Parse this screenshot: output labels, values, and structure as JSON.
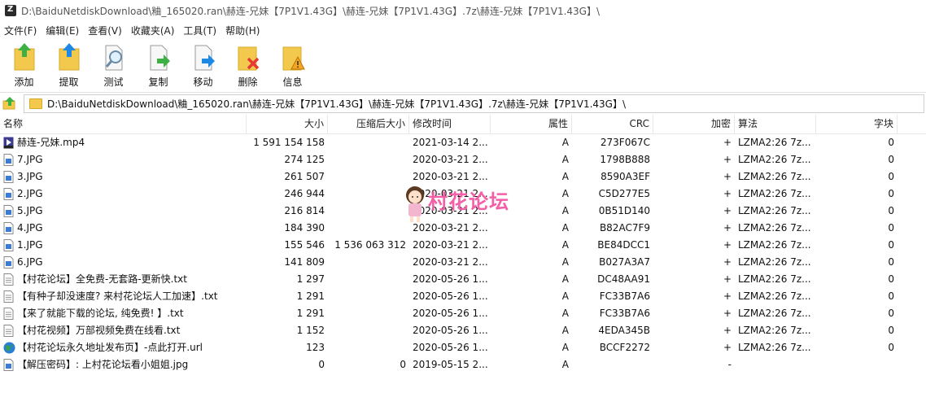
{
  "window": {
    "title": "D:\\BaiduNetdiskDownload\\粬_165020.ran\\赫连-兄妹【7P1V1.43G】\\赫连-兄妹【7P1V1.43G】.7z\\赫连-兄妹【7P1V1.43G】\\"
  },
  "menu": [
    {
      "label": "文件(F)"
    },
    {
      "label": "编辑(E)"
    },
    {
      "label": "查看(V)"
    },
    {
      "label": "收藏夹(A)"
    },
    {
      "label": "工具(T)"
    },
    {
      "label": "帮助(H)"
    }
  ],
  "toolbar": [
    {
      "label": "添加",
      "icon": "add-icon"
    },
    {
      "label": "提取",
      "icon": "extract-icon"
    },
    {
      "label": "测试",
      "icon": "test-icon"
    },
    {
      "label": "复制",
      "icon": "copy-icon"
    },
    {
      "label": "移动",
      "icon": "move-icon"
    },
    {
      "label": "删除",
      "icon": "delete-icon"
    },
    {
      "label": "信息",
      "icon": "info-icon"
    }
  ],
  "address": {
    "path": "D:\\BaiduNetdiskDownload\\粬_165020.ran\\赫连-兄妹【7P1V1.43G】\\赫连-兄妹【7P1V1.43G】.7z\\赫连-兄妹【7P1V1.43G】\\"
  },
  "columns": {
    "name": "名称",
    "size": "大小",
    "packed": "压缩后大小",
    "modified": "修改时间",
    "attr": "属性",
    "crc": "CRC",
    "encrypted": "加密",
    "method": "算法",
    "block": "字块"
  },
  "files": [
    {
      "name": "赫连-兄妹.mp4",
      "type": "video",
      "size": "1 591 154 158",
      "packed": "",
      "modified": "2021-03-14 2...",
      "attr": "A",
      "crc": "273F067C",
      "enc": "+",
      "method": "LZMA2:26 7z...",
      "block": "0"
    },
    {
      "name": "7.JPG",
      "type": "image",
      "size": "274 125",
      "packed": "",
      "modified": "2020-03-21 2...",
      "attr": "A",
      "crc": "1798B888",
      "enc": "+",
      "method": "LZMA2:26 7z...",
      "block": "0"
    },
    {
      "name": "3.JPG",
      "type": "image",
      "size": "261 507",
      "packed": "",
      "modified": "2020-03-21 2...",
      "attr": "A",
      "crc": "8590A3EF",
      "enc": "+",
      "method": "LZMA2:26 7z...",
      "block": "0"
    },
    {
      "name": "2.JPG",
      "type": "image",
      "size": "246 944",
      "packed": "",
      "modified": "2020-03-21 2...",
      "attr": "A",
      "crc": "C5D277E5",
      "enc": "+",
      "method": "LZMA2:26 7z...",
      "block": "0"
    },
    {
      "name": "5.JPG",
      "type": "image",
      "size": "216 814",
      "packed": "",
      "modified": "2020-03-21 2...",
      "attr": "A",
      "crc": "0B51D140",
      "enc": "+",
      "method": "LZMA2:26 7z...",
      "block": "0"
    },
    {
      "name": "4.JPG",
      "type": "image",
      "size": "184 390",
      "packed": "",
      "modified": "2020-03-21 2...",
      "attr": "A",
      "crc": "B82AC7F9",
      "enc": "+",
      "method": "LZMA2:26 7z...",
      "block": "0"
    },
    {
      "name": "1.JPG",
      "type": "image",
      "size": "155 546",
      "packed": "1 536 063 312",
      "modified": "2020-03-21 2...",
      "attr": "A",
      "crc": "BE84DCC1",
      "enc": "+",
      "method": "LZMA2:26 7z...",
      "block": "0"
    },
    {
      "name": "6.JPG",
      "type": "image",
      "size": "141 809",
      "packed": "",
      "modified": "2020-03-21 2...",
      "attr": "A",
      "crc": "B027A3A7",
      "enc": "+",
      "method": "LZMA2:26 7z...",
      "block": "0"
    },
    {
      "name": "【村花论坛】全免费-无套路-更新快.txt",
      "type": "text",
      "size": "1 297",
      "packed": "",
      "modified": "2020-05-26 1...",
      "attr": "A",
      "crc": "DC48AA91",
      "enc": "+",
      "method": "LZMA2:26 7z...",
      "block": "0"
    },
    {
      "name": "【有种子却没速度? 来村花论坛人工加速】.txt",
      "type": "text",
      "size": "1 291",
      "packed": "",
      "modified": "2020-05-26 1...",
      "attr": "A",
      "crc": "FC33B7A6",
      "enc": "+",
      "method": "LZMA2:26 7z...",
      "block": "0"
    },
    {
      "name": "【来了就能下载的论坛, 纯免费! 】.txt",
      "type": "text",
      "size": "1 291",
      "packed": "",
      "modified": "2020-05-26 1...",
      "attr": "A",
      "crc": "FC33B7A6",
      "enc": "+",
      "method": "LZMA2:26 7z...",
      "block": "0"
    },
    {
      "name": "【村花视频】万部视频免费在线看.txt",
      "type": "text",
      "size": "1 152",
      "packed": "",
      "modified": "2020-05-26 1...",
      "attr": "A",
      "crc": "4EDA345B",
      "enc": "+",
      "method": "LZMA2:26 7z...",
      "block": "0"
    },
    {
      "name": "【村花论坛永久地址发布页】-点此打开.url",
      "type": "url",
      "size": "123",
      "packed": "",
      "modified": "2020-05-26 1...",
      "attr": "A",
      "crc": "BCCF2272",
      "enc": "+",
      "method": "LZMA2:26 7z...",
      "block": "0"
    },
    {
      "name": "【解压密码】: 上村花论坛看小姐姐.jpg",
      "type": "image",
      "size": "0",
      "packed": "0",
      "modified": "2019-05-15 2...",
      "attr": "A",
      "crc": "",
      "enc": "-",
      "method": "",
      "block": ""
    }
  ],
  "watermark": {
    "text": "村花论坛",
    "color": "#f45fa8"
  },
  "colors": {
    "folder": "#f2c94c",
    "arrow_green": "#3cb043",
    "arrow_blue": "#1e88e5",
    "delete_red": "#e53935"
  }
}
